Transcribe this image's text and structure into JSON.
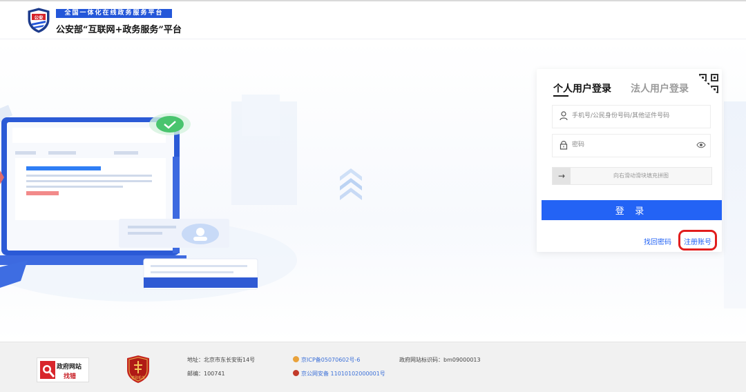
{
  "header": {
    "tagline": "全国一体化在线政务服务平台",
    "title": "公安部“互联网+政务服务”平台",
    "logo_text": "公安"
  },
  "login": {
    "tabs": [
      {
        "label": "个人用户登录",
        "active": true
      },
      {
        "label": "法人用户登录",
        "active": false
      }
    ],
    "username_placeholder": "手机号/公民身份号码/其他证件号码",
    "password_placeholder": "密码",
    "slider_arrow": "→",
    "slider_text": "向右滑动滑块填充拼图",
    "submit_label": "登 录",
    "forgot_label": "找回密码",
    "register_label": "注册账号"
  },
  "footer": {
    "gov_badge_line1": "政府网站",
    "gov_badge_line2": "找错",
    "party_badge_label": "党政机关",
    "address": "地址：北京市东长安街14号",
    "postcode": "邮编：100741",
    "icp": "京ICP备05070602号-6",
    "police_record": "京公网安备 11010102000001号",
    "site_code": "政府网站标识码：bm09000013"
  },
  "colors": {
    "primary": "#2363f5",
    "highlight": "#e11d1d",
    "header_blue": "#2457d9"
  }
}
